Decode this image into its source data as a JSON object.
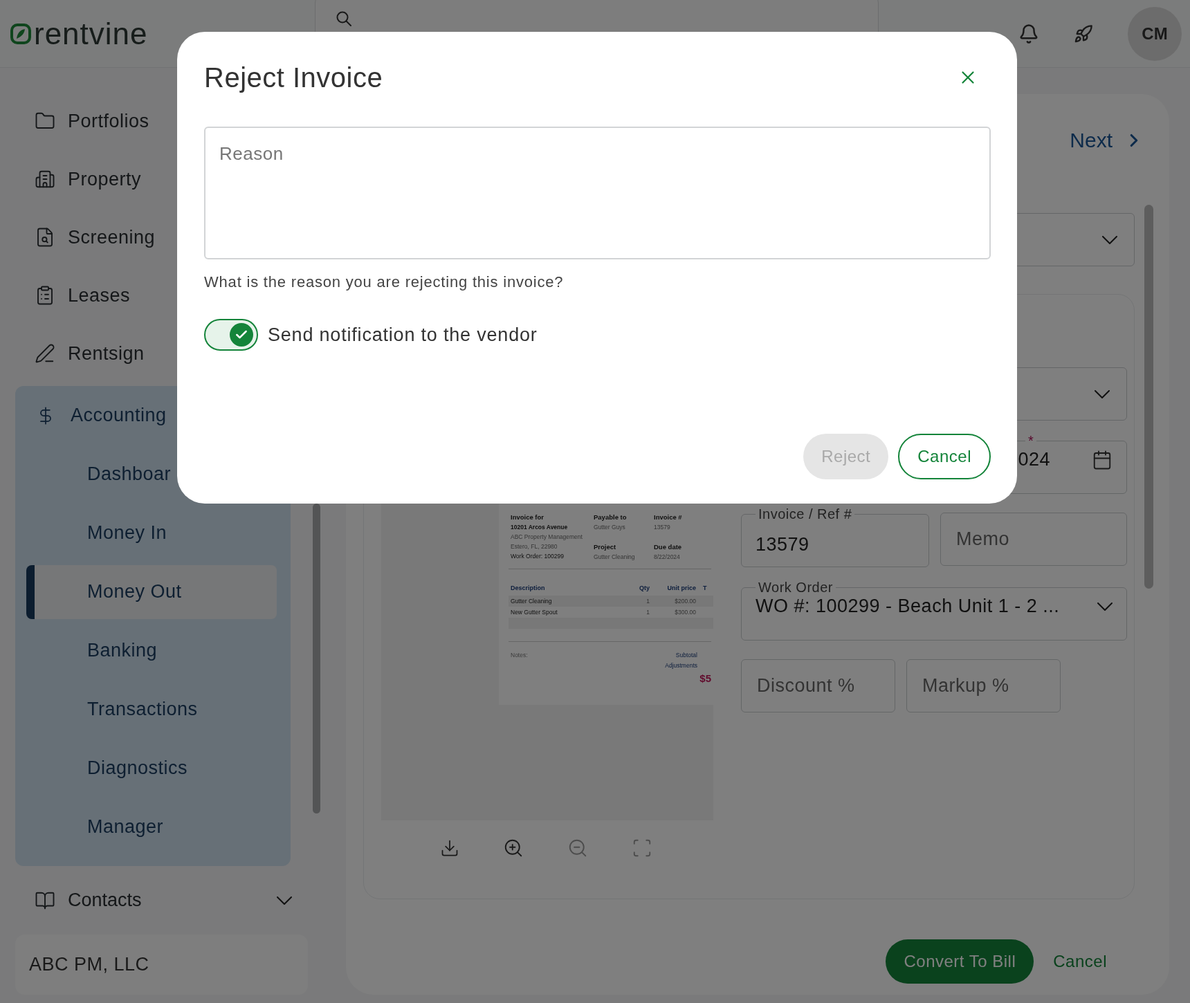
{
  "header": {
    "logo": "rentvine",
    "avatar": "CM"
  },
  "sidebar": {
    "items": [
      {
        "label": "Portfolios"
      },
      {
        "label": "Property"
      },
      {
        "label": "Screening"
      },
      {
        "label": "Leases"
      },
      {
        "label": "Rentsign"
      }
    ],
    "accounting": {
      "label": "Accounting",
      "items": [
        {
          "label": "Dashboar",
          "selected": false
        },
        {
          "label": "Money In",
          "selected": false
        },
        {
          "label": "Money Out",
          "selected": true
        },
        {
          "label": "Banking",
          "selected": false
        },
        {
          "label": "Transactions",
          "selected": false
        },
        {
          "label": "Diagnostics",
          "selected": false
        },
        {
          "label": "Manager",
          "selected": false
        }
      ]
    },
    "contacts": {
      "label": "Contacts",
      "expanded": false
    },
    "company": "ABC PM, LLC"
  },
  "main": {
    "pager": {
      "next": "Next"
    },
    "date_field": {
      "required_mark": "*",
      "value": "024"
    },
    "invoice_ref": {
      "label": "Invoice / Ref #",
      "value": "13579"
    },
    "memo": {
      "placeholder": "Memo"
    },
    "work_order": {
      "label": "Work Order",
      "value": "WO #: 100299 - Beach Unit 1 - 2 ..."
    },
    "discount": {
      "placeholder": "Discount %"
    },
    "markup": {
      "placeholder": "Markup %"
    },
    "document": {
      "invoice_for": {
        "label": "Invoice for",
        "lines": [
          {
            "text": "10201 Arcos Avenue",
            "kind": "strong"
          },
          {
            "text": "ABC Property Management",
            "kind": "muted"
          },
          {
            "text": "Estero, FL, 22980",
            "kind": "muted"
          },
          {
            "text": "Work Order: 100299",
            "kind": "plain"
          }
        ]
      },
      "payable_to": {
        "label": "Payable to",
        "value": "Gutter Guys"
      },
      "invoice_no": {
        "label": "Invoice #",
        "value": "13579"
      },
      "project": {
        "label": "Project",
        "value": "Gutter Cleaning"
      },
      "due_date": {
        "label": "Due date",
        "value": "8/22/2024"
      },
      "table": {
        "columns": [
          "Description",
          "Qty",
          "Unit price",
          "T"
        ],
        "rows": [
          [
            "Gutter Cleaning",
            "1",
            "$200.00"
          ],
          [
            "New Gutter Spout",
            "1",
            "$300.00"
          ]
        ]
      },
      "notes": "Notes:",
      "subtotal": "Subtotal",
      "adjustments": "Adjustments",
      "total": "$5"
    },
    "actions": {
      "convert": "Convert To Bill",
      "cancel": "Cancel"
    }
  },
  "modal": {
    "title": "Reject Invoice",
    "reason": {
      "placeholder": "Reason"
    },
    "hint": "What is the reason you are rejecting this invoice?",
    "notify": {
      "label": "Send notification to the vendor",
      "on": true
    },
    "buttons": [
      {
        "label": "Reject",
        "kind": "primary",
        "disabled": true
      },
      {
        "label": "Cancel",
        "kind": "outline",
        "disabled": false
      }
    ]
  }
}
